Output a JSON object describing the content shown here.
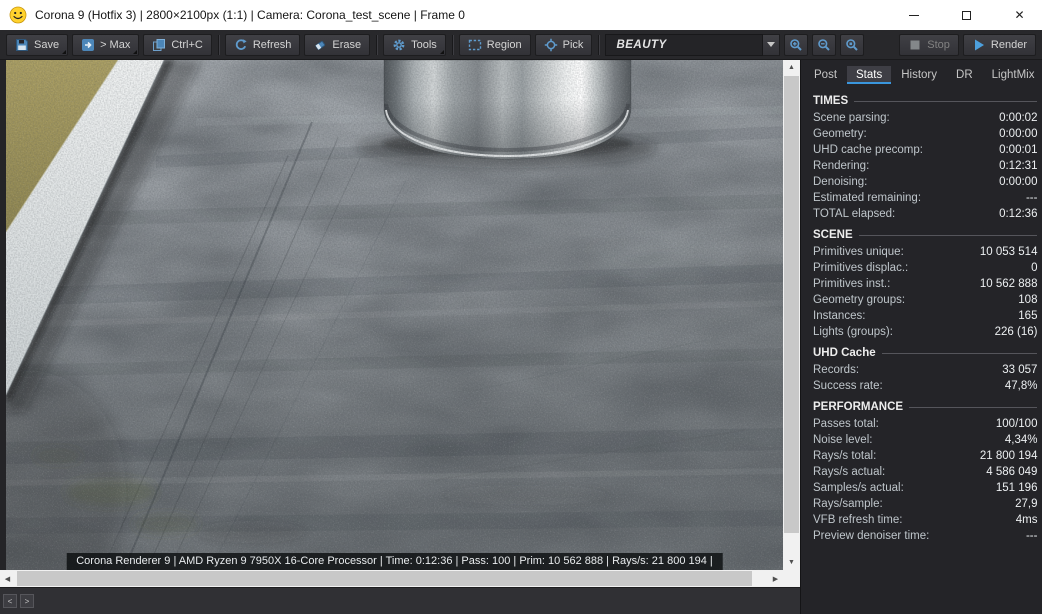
{
  "window": {
    "title": "Corona 9 (Hotfix 3) | 2800×2100px (1:1) | Camera: Corona_test_scene | Frame 0",
    "controls": {
      "minimize": "–",
      "maximize": "□",
      "close": "✕"
    }
  },
  "colors": {
    "accent_blue": "#3a96dd",
    "icon_blue": "#5f9bcd",
    "titlebar_bg": "#ffffff",
    "panel_bg": "#242428",
    "toolbar_bg": "#28282b"
  },
  "icons": {
    "smiley": "smiley-face",
    "save": "floppy-disk",
    "send_max": "arrow-right-box",
    "copy": "copy-pages",
    "refresh": "circular-arrow",
    "erase": "eraser",
    "tools": "gear",
    "region": "dashed-rectangle",
    "pick": "crosshair",
    "zoom_in": "magnifier-plus",
    "zoom_out": "magnifier-minus",
    "zoom_fit": "magnifier-box",
    "stop": "stop-square",
    "render": "play-triangle"
  },
  "toolbar": {
    "save": "Save",
    "max": "> Max",
    "copy": "Ctrl+C",
    "refresh": "Refresh",
    "erase": "Erase",
    "tools": "Tools",
    "region": "Region",
    "pick": "Pick",
    "channel": "BEAUTY",
    "stop": "Stop",
    "render": "Render"
  },
  "viewport": {
    "statusbar": "Corona Renderer 9 | AMD Ryzen 9 7950X 16-Core Processor  | Time: 0:12:36 | Pass: 100 | Prim: 10 562 888 | Rays/s: 21 800 194 |"
  },
  "scrollbar": {
    "up": "▲",
    "down": "▼",
    "left": "◀",
    "right": "▶"
  },
  "nav": {
    "prev": "<",
    "next": ">"
  },
  "panel": {
    "tabs": [
      {
        "label": "Post",
        "active": false,
        "right_group": false
      },
      {
        "label": "Stats",
        "active": true,
        "right_group": false
      },
      {
        "label": "History",
        "active": false,
        "right_group": false
      },
      {
        "label": "DR",
        "active": false,
        "right_group": true
      },
      {
        "label": "LightMix",
        "active": false,
        "right_group": false
      }
    ],
    "sections": [
      {
        "title": "TIMES",
        "rows": [
          {
            "label": "Scene parsing:",
            "value": "0:00:02"
          },
          {
            "label": "Geometry:",
            "value": "0:00:00"
          },
          {
            "label": "UHD cache precomp:",
            "value": "0:00:01"
          },
          {
            "label": "Rendering:",
            "value": "0:12:31"
          },
          {
            "label": "Denoising:",
            "value": "0:00:00"
          },
          {
            "label": "Estimated remaining:",
            "value": "---"
          },
          {
            "label": "TOTAL elapsed:",
            "value": "0:12:36"
          }
        ]
      },
      {
        "title": "SCENE",
        "rows": [
          {
            "label": "Primitives unique:",
            "value": "10 053 514"
          },
          {
            "label": "Primitives displac.:",
            "value": "0"
          },
          {
            "label": "Primitives inst.:",
            "value": "10 562 888"
          },
          {
            "label": "Geometry groups:",
            "value": "108"
          },
          {
            "label": "Instances:",
            "value": "165"
          },
          {
            "label": "Lights (groups):",
            "value": "226 (16)"
          }
        ]
      },
      {
        "title": "UHD Cache",
        "rows": [
          {
            "label": "Records:",
            "value": "33 057"
          },
          {
            "label": "Success rate:",
            "value": "47,8%"
          }
        ]
      },
      {
        "title": "PERFORMANCE",
        "rows": [
          {
            "label": "Passes total:",
            "value": "100/100"
          },
          {
            "label": "Noise level:",
            "value": "4,34%"
          },
          {
            "label": "Rays/s total:",
            "value": "21 800 194"
          },
          {
            "label": "Rays/s actual:",
            "value": "4 586 049"
          },
          {
            "label": "Samples/s actual:",
            "value": "151 196"
          },
          {
            "label": "Rays/sample:",
            "value": "27,9"
          },
          {
            "label": "VFB refresh time:",
            "value": "4ms"
          },
          {
            "label": "Preview denoiser time:",
            "value": "---"
          }
        ]
      }
    ]
  }
}
